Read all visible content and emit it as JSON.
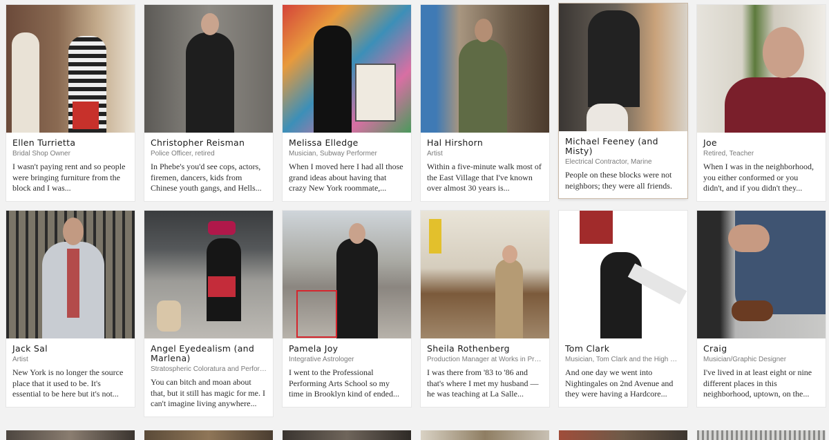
{
  "people": [
    {
      "name": "Ellen Turrietta",
      "role": "Bridal Shop Owner",
      "quote": "I wasn't paying rent and so people were bringing furniture from the block and I was..."
    },
    {
      "name": "Christopher Reisman",
      "role": "Police Officer, retired",
      "quote": "In Phebe's you'd see cops, actors, firemen, dancers, kids from Chinese youth gangs, and Hells..."
    },
    {
      "name": "Melissa Elledge",
      "role": "Musician, Subway Performer",
      "quote": "When I moved here I had all those grand ideas about having that crazy New York roommate,..."
    },
    {
      "name": "Hal Hirshorn",
      "role": "Artist",
      "quote": "Within a five-minute walk most of the East Village that I've known over almost 30 years is..."
    },
    {
      "name": "Michael Feeney (and Misty)",
      "role": "Electrical Contractor, Marine",
      "quote": "People on these blocks were not neighbors; they were all friends."
    },
    {
      "name": "Joe",
      "role": "Retired, Teacher",
      "quote": "When I was in the neighborhood, you either conformed or you didn't, and if you didn't they..."
    },
    {
      "name": "Jack Sal",
      "role": "Artist",
      "quote": "New York is no longer the source place that it used to be. It's essential to be here but it's not..."
    },
    {
      "name": "Angel Eyedealism (and Marlena)",
      "role": "Stratospheric Coloratura and Performance Artist",
      "quote": "You can bitch and moan about that, but it still has magic for me. I can't imagine living anywhere..."
    },
    {
      "name": "Pamela Joy",
      "role": "Integrative Astrologer",
      "quote": "I went to the Professional Performing Arts School so my time in Brooklyn kind of ended..."
    },
    {
      "name": "Sheila Rothenberg",
      "role": "Production Manager at Works in Progress",
      "quote": "I was there from '83 to '86 and that's where I met my husband — he was teaching at La Salle..."
    },
    {
      "name": "Tom Clark",
      "role": "Musician, Tom Clark and the High Road",
      "quote": "And one day we went into Nightingales on 2nd Avenue and they were having a Hardcore..."
    },
    {
      "name": "Craig",
      "role": "Musician/Graphic Designer",
      "quote": "I've lived in at least eight or nine different places in this neighborhood, uptown, on the..."
    }
  ]
}
